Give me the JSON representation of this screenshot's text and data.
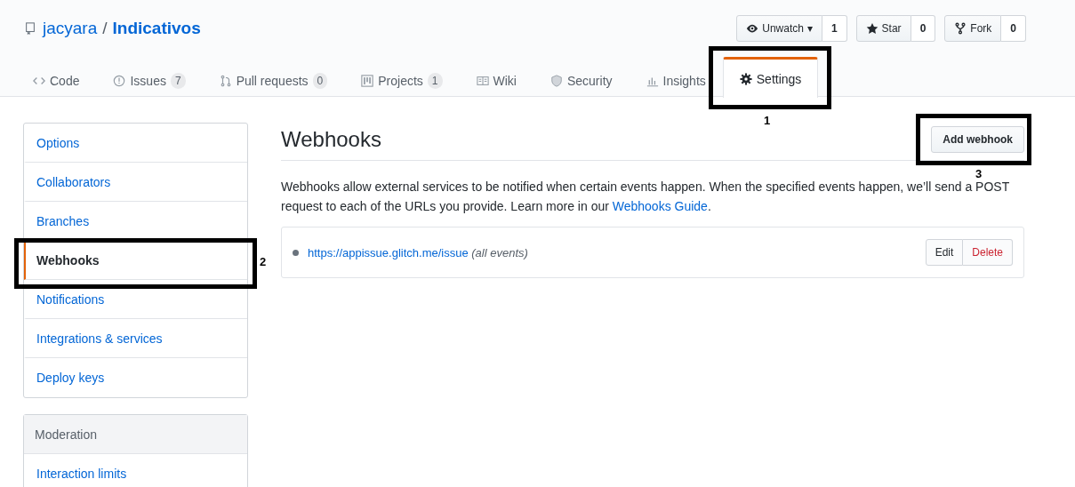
{
  "repo": {
    "owner": "jacyara",
    "separator": "/",
    "name": "Indicativos"
  },
  "actions": [
    {
      "kind": "watch",
      "label": "Unwatch",
      "caret": "▾",
      "count": "1"
    },
    {
      "kind": "star",
      "label": "Star",
      "count": "0"
    },
    {
      "kind": "fork",
      "label": "Fork",
      "count": "0"
    }
  ],
  "tabs": [
    {
      "kind": "code",
      "label": "Code",
      "selected": false
    },
    {
      "kind": "issues",
      "label": "Issues",
      "counter": "7",
      "selected": false
    },
    {
      "kind": "pull",
      "label": "Pull requests",
      "counter": "0",
      "selected": false
    },
    {
      "kind": "projects",
      "label": "Projects",
      "counter": "1",
      "selected": false
    },
    {
      "kind": "wiki",
      "label": "Wiki",
      "selected": false
    },
    {
      "kind": "security",
      "label": "Security",
      "selected": false
    },
    {
      "kind": "insights",
      "label": "Insights",
      "selected": false
    },
    {
      "kind": "settings",
      "label": "Settings",
      "selected": true
    }
  ],
  "sidebar": {
    "items": [
      {
        "label": "Options",
        "selected": false
      },
      {
        "label": "Collaborators",
        "selected": false
      },
      {
        "label": "Branches",
        "selected": false
      },
      {
        "label": "Webhooks",
        "selected": true
      },
      {
        "label": "Notifications",
        "selected": false
      },
      {
        "label": "Integrations & services",
        "selected": false
      },
      {
        "label": "Deploy keys",
        "selected": false
      }
    ],
    "moderation": {
      "heading": "Moderation",
      "items": [
        {
          "label": "Interaction limits",
          "selected": false
        }
      ]
    }
  },
  "main": {
    "title": "Webhooks",
    "add_button": "Add webhook",
    "description": {
      "text": "Webhooks allow external services to be notified when certain events happen. When the specified events happen, we’ll send a POST request to each of the URLs you provide. Learn more in our ",
      "link": "Webhooks Guide",
      "after": "."
    },
    "hooks": [
      {
        "url": "https://appissue.glitch.me/issue",
        "events": "(all events)",
        "edit": "Edit",
        "delete": "Delete"
      }
    ]
  },
  "annotations": [
    {
      "label": "1"
    },
    {
      "label": "2"
    },
    {
      "label": "3"
    }
  ]
}
